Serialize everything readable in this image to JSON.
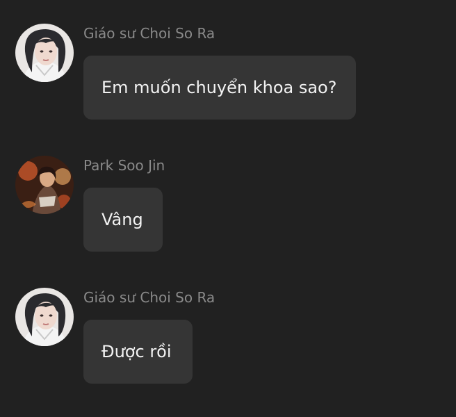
{
  "messages": [
    {
      "sender": "Giáo sư Choi So Ra",
      "text": "Em muốn chuyển khoa sao?",
      "avatar": "professor-avatar"
    },
    {
      "sender": "Park Soo Jin",
      "text": "Vâng",
      "avatar": "student-avatar"
    },
    {
      "sender": "Giáo sư Choi So Ra",
      "text": "Được rồi",
      "avatar": "professor-avatar"
    }
  ],
  "colors": {
    "background": "#212121",
    "bubble": "#353535",
    "sender_name": "#8a8a8a",
    "message_text": "#f2f2f2"
  }
}
